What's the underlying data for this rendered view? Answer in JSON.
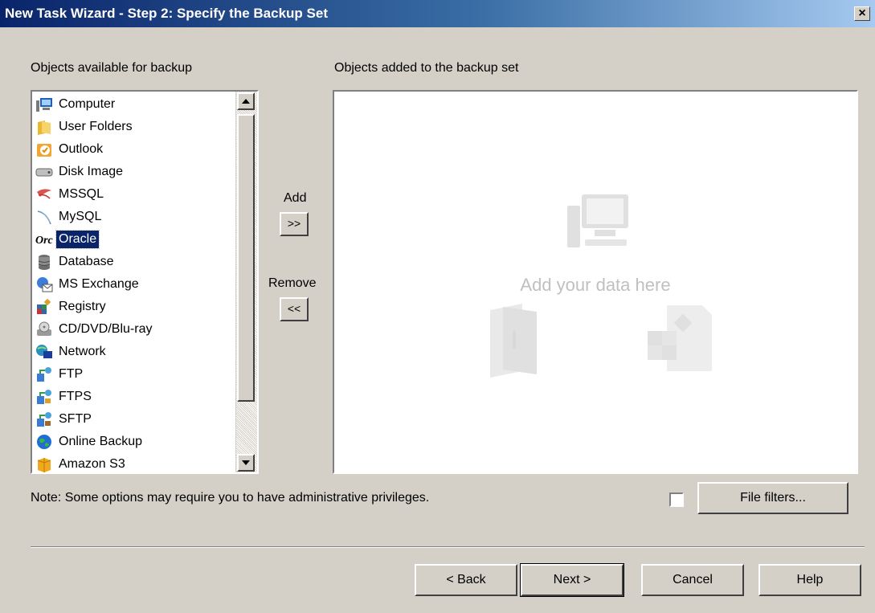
{
  "window": {
    "title": "New Task Wizard - Step 2: Specify the Backup Set",
    "close_label": "×"
  },
  "left_panel": {
    "label": "Objects available for backup",
    "items": [
      {
        "label": "Computer",
        "icon": "computer-icon"
      },
      {
        "label": "User Folders",
        "icon": "user-folders-icon"
      },
      {
        "label": "Outlook",
        "icon": "outlook-icon"
      },
      {
        "label": "Disk Image",
        "icon": "disk-image-icon"
      },
      {
        "label": "MSSQL",
        "icon": "mssql-icon"
      },
      {
        "label": "MySQL",
        "icon": "mysql-icon"
      },
      {
        "label": "Oracle",
        "icon": "oracle-icon",
        "selected": true
      },
      {
        "label": "Database",
        "icon": "database-icon"
      },
      {
        "label": "MS Exchange",
        "icon": "ms-exchange-icon"
      },
      {
        "label": "Registry",
        "icon": "registry-icon"
      },
      {
        "label": "CD/DVD/Blu-ray",
        "icon": "cd-dvd-icon"
      },
      {
        "label": "Network",
        "icon": "network-icon"
      },
      {
        "label": "FTP",
        "icon": "ftp-icon"
      },
      {
        "label": "FTPS",
        "icon": "ftps-icon"
      },
      {
        "label": "SFTP",
        "icon": "sftp-icon"
      },
      {
        "label": "Online Backup",
        "icon": "online-backup-icon"
      },
      {
        "label": "Amazon S3",
        "icon": "amazon-s3-icon"
      }
    ]
  },
  "middle": {
    "add_label": "Add",
    "add_button": ">>",
    "remove_label": "Remove",
    "remove_button": "<<"
  },
  "right_panel": {
    "label": "Objects added to the backup set",
    "placeholder": "Add your data here"
  },
  "note": "Note: Some options may require you to have administrative privileges.",
  "file_filters": {
    "checked": false,
    "button_label": "File filters..."
  },
  "footer": {
    "back_label": "< Back",
    "next_label": "Next >",
    "cancel_label": "Cancel",
    "help_label": "Help"
  },
  "colors": {
    "selection": "#0a246a",
    "dialog_bg": "#d4d0c8"
  }
}
